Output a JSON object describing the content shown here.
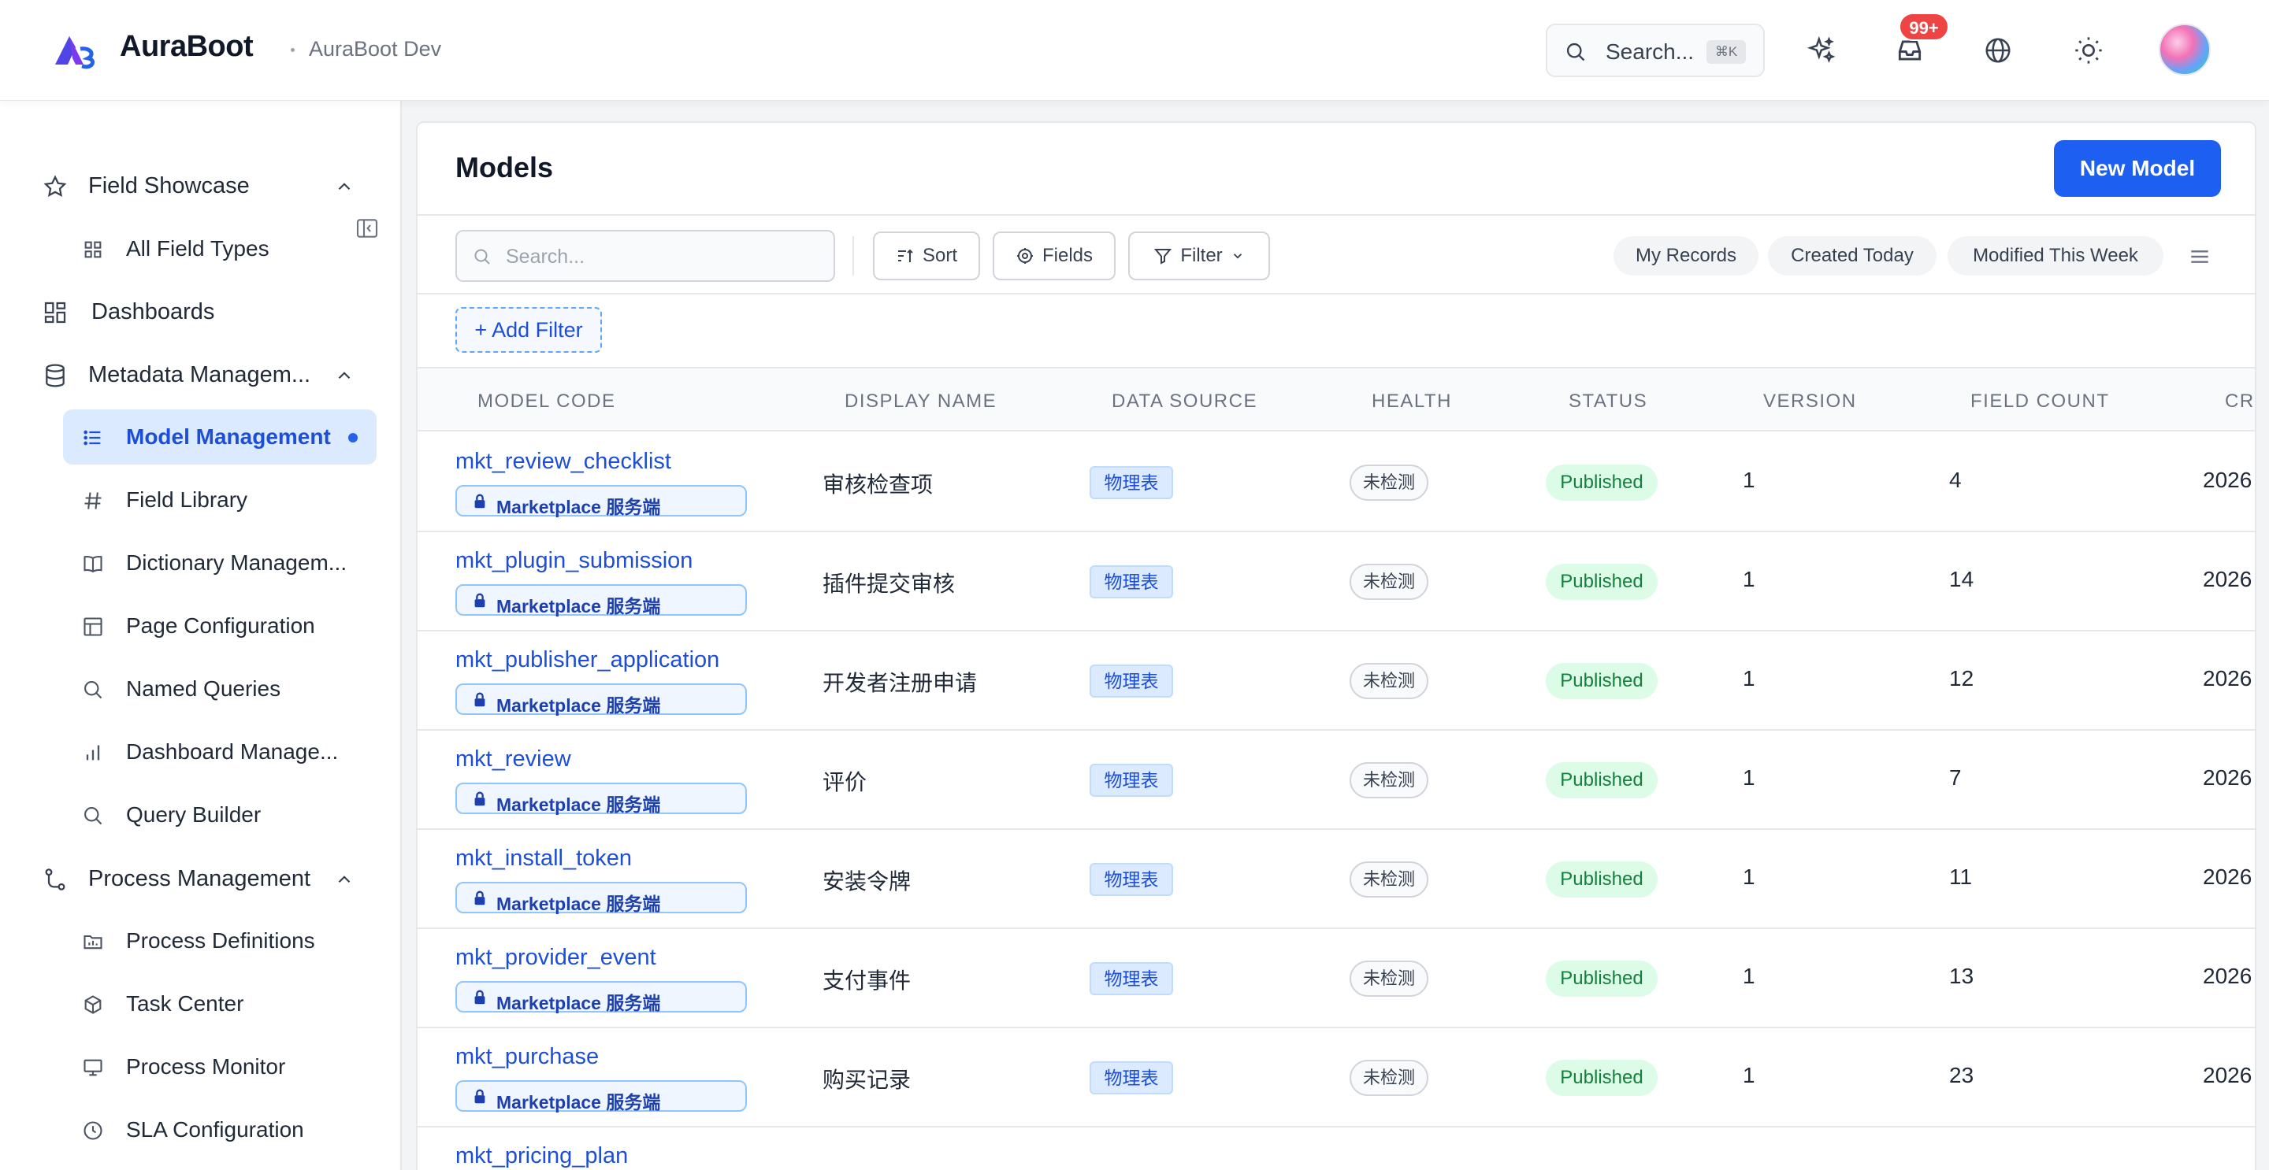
{
  "header": {
    "brand": "AuraBoot",
    "env": "AuraBoot Dev",
    "search_label": "Search...",
    "search_shortcut": "⌘K",
    "notification_count": "99+"
  },
  "sidebar": {
    "groups": [
      {
        "label": "Field Showcase",
        "icon": "star-icon",
        "expanded": true,
        "items": [
          {
            "label": "All Field Types",
            "icon": "grid-icon"
          }
        ]
      },
      {
        "label": "Dashboards",
        "icon": "dashboard-icon"
      },
      {
        "label": "Metadata Managem...",
        "icon": "database-icon",
        "expanded": true,
        "items": [
          {
            "label": "Model Management",
            "icon": "list-icon",
            "active": true
          },
          {
            "label": "Field Library",
            "icon": "hash-icon"
          },
          {
            "label": "Dictionary Managem...",
            "icon": "book-icon"
          },
          {
            "label": "Page Configuration",
            "icon": "layout-icon"
          },
          {
            "label": "Named Queries",
            "icon": "search-icon"
          },
          {
            "label": "Dashboard Manage...",
            "icon": "bar-chart-icon"
          },
          {
            "label": "Query Builder",
            "icon": "search-icon"
          }
        ]
      },
      {
        "label": "Process Management",
        "icon": "workflow-icon",
        "expanded": true,
        "items": [
          {
            "label": "Process Definitions",
            "icon": "folder-chart-icon"
          },
          {
            "label": "Task Center",
            "icon": "cube-icon"
          },
          {
            "label": "Process Monitor",
            "icon": "monitor-icon"
          },
          {
            "label": "SLA Configuration",
            "icon": "clock-icon"
          }
        ]
      }
    ]
  },
  "main": {
    "title": "Models",
    "new_button": "New Model",
    "search_placeholder": "Search...",
    "toolbar": {
      "sort": "Sort",
      "fields": "Fields",
      "filter": "Filter"
    },
    "quick_filters": [
      "My Records",
      "Created Today",
      "Modified This Week"
    ],
    "add_filter": "+ Add Filter",
    "columns": [
      "MODEL CODE",
      "DISPLAY NAME",
      "DATA SOURCE",
      "HEALTH",
      "STATUS",
      "VERSION",
      "FIELD COUNT",
      "CRE"
    ],
    "rows": [
      {
        "code": "mkt_review_checklist",
        "app": "Marketplace 服务端",
        "display_name": "审核检查项",
        "source": "物理表",
        "health": "未检测",
        "status": "Published",
        "version": "1",
        "field_count": "4",
        "created": "2026"
      },
      {
        "code": "mkt_plugin_submission",
        "app": "Marketplace 服务端",
        "display_name": "插件提交审核",
        "source": "物理表",
        "health": "未检测",
        "status": "Published",
        "version": "1",
        "field_count": "14",
        "created": "2026"
      },
      {
        "code": "mkt_publisher_application",
        "app": "Marketplace 服务端",
        "display_name": "开发者注册申请",
        "source": "物理表",
        "health": "未检测",
        "status": "Published",
        "version": "1",
        "field_count": "12",
        "created": "2026"
      },
      {
        "code": "mkt_review",
        "app": "Marketplace 服务端",
        "display_name": "评价",
        "source": "物理表",
        "health": "未检测",
        "status": "Published",
        "version": "1",
        "field_count": "7",
        "created": "2026"
      },
      {
        "code": "mkt_install_token",
        "app": "Marketplace 服务端",
        "display_name": "安装令牌",
        "source": "物理表",
        "health": "未检测",
        "status": "Published",
        "version": "1",
        "field_count": "11",
        "created": "2026"
      },
      {
        "code": "mkt_provider_event",
        "app": "Marketplace 服务端",
        "display_name": "支付事件",
        "source": "物理表",
        "health": "未检测",
        "status": "Published",
        "version": "1",
        "field_count": "13",
        "created": "2026"
      },
      {
        "code": "mkt_purchase",
        "app": "Marketplace 服务端",
        "display_name": "购买记录",
        "source": "物理表",
        "health": "未检测",
        "status": "Published",
        "version": "1",
        "field_count": "23",
        "created": "2026"
      },
      {
        "code": "mkt_pricing_plan",
        "app": "",
        "display_name": "",
        "source": "",
        "health": "",
        "status": "",
        "version": "",
        "field_count": "",
        "created": ""
      }
    ]
  },
  "colors": {
    "accent": "#1d5ff0",
    "link": "#1d4ed8",
    "published_bg": "#dcfce7",
    "published_text": "#15803d",
    "badge_red": "#ef4444"
  }
}
